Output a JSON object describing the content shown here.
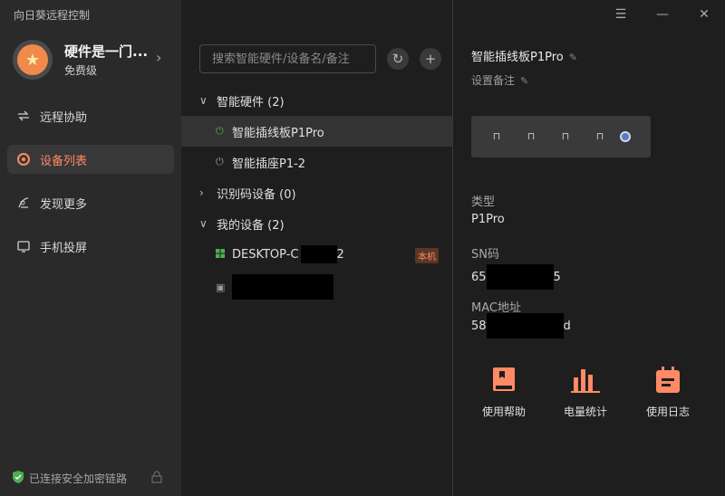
{
  "app": {
    "title": "向日葵远程控制"
  },
  "profile": {
    "name": "硬件是一门...",
    "level": "免费级"
  },
  "nav": [
    {
      "label": "远程协助",
      "icon": "remote-assist-icon"
    },
    {
      "label": "设备列表",
      "icon": "device-list-icon",
      "active": true
    },
    {
      "label": "发现更多",
      "icon": "discover-icon"
    },
    {
      "label": "手机投屏",
      "icon": "screen-cast-icon"
    }
  ],
  "status": {
    "text": "已连接安全加密链路"
  },
  "search": {
    "placeholder": "搜索智能硬件/设备名/备注"
  },
  "tree": {
    "group_hardware": "智能硬件 (2)",
    "device_p1pro": "智能插线板P1Pro",
    "device_p1_2": "智能插座P1-2",
    "group_idcode": "识别码设备 (0)",
    "group_mine": "我的设备 (2)",
    "device_desktop_prefix": "DESKTOP-C",
    "device_desktop_suffix": "2",
    "badge_local": "本机"
  },
  "detail": {
    "title": "智能插线板P1Pro",
    "note": "设置备注",
    "type_label": "类型",
    "type_value": "P1Pro",
    "sn_label": "SN码",
    "sn_prefix": "65",
    "sn_suffix": "5",
    "mac_label": "MAC地址",
    "mac_prefix": "58",
    "mac_suffix": "d"
  },
  "actions": [
    {
      "label": "使用帮助",
      "icon": "help-book-icon"
    },
    {
      "label": "电量统计",
      "icon": "power-stats-icon"
    },
    {
      "label": "使用日志",
      "icon": "usage-log-icon"
    }
  ],
  "colors": {
    "accent": "#ff8a65",
    "sidebar": "#2a2a2a",
    "background": "#1e1e1e"
  }
}
